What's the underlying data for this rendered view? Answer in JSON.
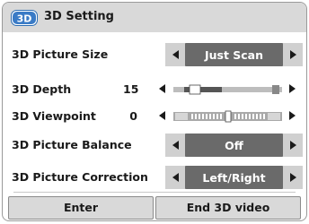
{
  "window": {
    "title": "3D Setting",
    "logo_text": "3D",
    "logo_icon": "3d-glasses-icon"
  },
  "rows": [
    {
      "label": "3D Picture Size",
      "value": "Just Scan"
    },
    {
      "label": "3D Depth",
      "number": "15",
      "bar_level": 0.3
    },
    {
      "label": "3D Viewpoint",
      "number": "0",
      "bar_level": 0.5
    },
    {
      "label": "3D Picture Balance",
      "value": "Off"
    },
    {
      "label": "3D Picture Correction",
      "value": "Left/Right"
    }
  ],
  "buttons": {
    "enter": "Enter",
    "end": "End 3D video"
  },
  "colors": {
    "selector_bg": "#d0d0d0",
    "value_bg": "#6a6a6a",
    "header_bg": "#d9d9d9"
  }
}
